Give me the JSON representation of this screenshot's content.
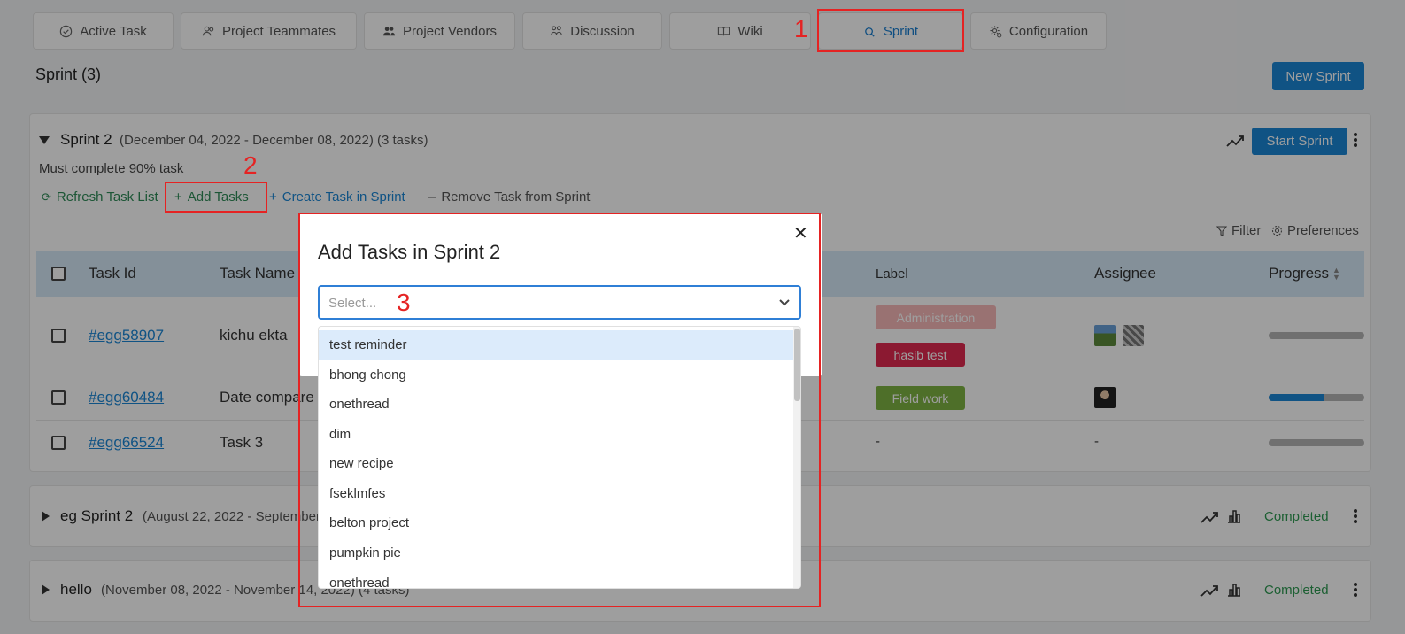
{
  "tabs": [
    {
      "label": "Active Task",
      "icon": "check-circle-icon"
    },
    {
      "label": "Project Teammates",
      "icon": "users-icon"
    },
    {
      "label": "Project Vendors",
      "icon": "vendors-icon"
    },
    {
      "label": "Discussion",
      "icon": "discussion-icon"
    },
    {
      "label": "Wiki",
      "icon": "book-icon"
    },
    {
      "label": "Sprint",
      "icon": "sprint-icon",
      "active": true
    },
    {
      "label": "Configuration",
      "icon": "gear-icon"
    }
  ],
  "annotations": {
    "one": "1",
    "two": "2",
    "three": "3"
  },
  "page": {
    "title": "Sprint (3)",
    "new_sprint": "New Sprint"
  },
  "sprint2": {
    "name": "Sprint 2",
    "dates": "(December 04, 2022 - December 08, 2022) (3 tasks)",
    "goal": "Must complete 90% task",
    "start_sprint": "Start Sprint",
    "actions": {
      "refresh": "Refresh Task List",
      "add": "Add Tasks",
      "create": "Create Task in Sprint",
      "remove": "Remove Task from Sprint"
    },
    "filter": "Filter",
    "preferences": "Preferences",
    "columns": {
      "task_id": "Task Id",
      "task_name": "Task Name",
      "label": "Label",
      "assignee": "Assignee",
      "progress": "Progress"
    },
    "rows": [
      {
        "id": "#egg58907",
        "name": "kichu ekta",
        "labels": [
          "Administration",
          "hasib test"
        ],
        "progress": 0
      },
      {
        "id": "#egg60484",
        "name": "Date compare",
        "labels": [
          "Field work"
        ],
        "progress": 0.57
      },
      {
        "id": "#egg66524",
        "name": "Task 3",
        "label_text": "-",
        "assignee_text": "-",
        "progress": 0
      }
    ]
  },
  "sprints_collapsed": [
    {
      "name": "eg Sprint 2",
      "dates": "(August 22, 2022 - September",
      "status": "Completed"
    },
    {
      "name": "hello",
      "dates": "(November 08, 2022 - November 14, 2022) (4 tasks)",
      "status": "Completed"
    }
  ],
  "modal": {
    "title": "Add Tasks in Sprint 2",
    "select_placeholder": "Select...",
    "options": [
      "test reminder",
      "bhong chong",
      "onethread",
      "dim",
      "new recipe",
      "fseklmfes",
      "belton project",
      "pumpkin pie",
      "onethread"
    ]
  },
  "colors": {
    "accent": "#1a86d6",
    "highlight": "#e52323",
    "label_administration": "#f7b9b9",
    "label_hasib": "#e0294f",
    "label_field": "#7fb343",
    "completed": "#2e9a52"
  }
}
